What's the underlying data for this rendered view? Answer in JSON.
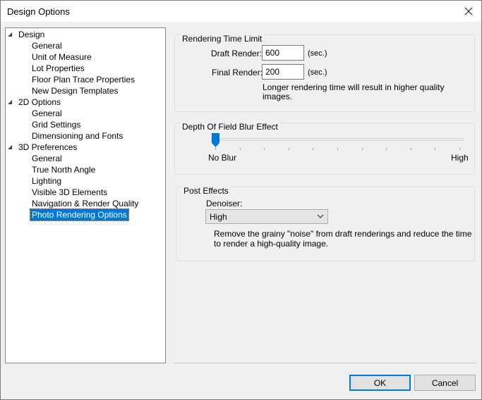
{
  "window": {
    "title": "Design Options"
  },
  "tree": {
    "items": [
      {
        "label": "Design",
        "level": 0,
        "expanded": true
      },
      {
        "label": "General",
        "level": 1
      },
      {
        "label": "Unit of Measure",
        "level": 1
      },
      {
        "label": "Lot Properties",
        "level": 1
      },
      {
        "label": "Floor Plan Trace Properties",
        "level": 1
      },
      {
        "label": "New Design Templates",
        "level": 1
      },
      {
        "label": "2D Options",
        "level": 0,
        "expanded": true
      },
      {
        "label": "General",
        "level": 1
      },
      {
        "label": "Grid Settings",
        "level": 1
      },
      {
        "label": "Dimensioning and Fonts",
        "level": 1
      },
      {
        "label": "3D Preferences",
        "level": 0,
        "expanded": true
      },
      {
        "label": "General",
        "level": 1
      },
      {
        "label": "True North Angle",
        "level": 1
      },
      {
        "label": "Lighting",
        "level": 1
      },
      {
        "label": "Visible 3D Elements",
        "level": 1
      },
      {
        "label": "Navigation & Render Quality",
        "level": 1
      },
      {
        "label": "Photo Rendering Options",
        "level": 1,
        "selected": true
      }
    ]
  },
  "rendering_time": {
    "title": "Rendering Time Limit",
    "draft_label": "Draft Render:",
    "draft_value": "600",
    "final_label": "Final Render:",
    "final_value": "200",
    "unit": "(sec.)",
    "note_line1": "Longer rendering time will result in higher quality",
    "note_line2": "images."
  },
  "depth_of_field": {
    "title": "Depth Of Field Blur Effect",
    "min_label": "No Blur",
    "max_label": "High",
    "value_fraction": 0,
    "tick_count": 10
  },
  "post_effects": {
    "title": "Post Effects",
    "denoiser_label": "Denoiser:",
    "denoiser_value": "High",
    "note_line1": "Remove the grainy \"noise\" from draft renderings and reduce the time",
    "note_line2": "to render a high-quality image."
  },
  "buttons": {
    "ok": "OK",
    "cancel": "Cancel"
  },
  "colors": {
    "accent": "#0078d7",
    "dialog_bg": "#f0f0f0"
  }
}
